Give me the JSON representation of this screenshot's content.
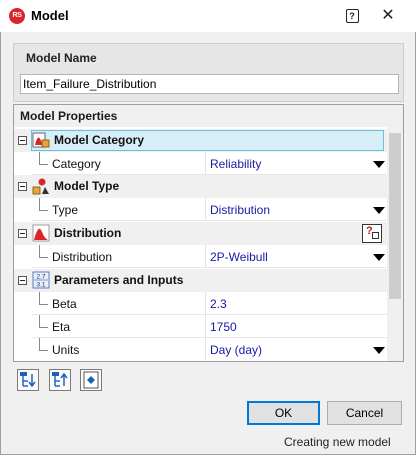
{
  "window": {
    "app_icon_text": "RS",
    "title": "Model",
    "help_glyph": "?",
    "close_glyph": "✕"
  },
  "model_name": {
    "label": "Model Name",
    "value": "Item_Failure_Distribution"
  },
  "properties": {
    "header": "Model Properties",
    "categories": [
      {
        "label": "Model Category",
        "icon": "model-category-icon",
        "selected": true,
        "props": [
          {
            "name": "Category",
            "value": "Reliability",
            "has_dropdown": true
          }
        ]
      },
      {
        "label": "Model Type",
        "icon": "model-type-icon",
        "props": [
          {
            "name": "Type",
            "value": "Distribution",
            "has_dropdown": true
          }
        ]
      },
      {
        "label": "Distribution",
        "icon": "distribution-icon",
        "has_info_button": true,
        "props": [
          {
            "name": "Distribution",
            "value": "2P-Weibull",
            "has_dropdown": true
          }
        ]
      },
      {
        "label": "Parameters and Inputs",
        "icon": "parameters-icon",
        "icon_text_top": "2.7",
        "icon_text_bottom": "3.1",
        "props": [
          {
            "name": "Beta",
            "value": "2.3"
          },
          {
            "name": "Eta",
            "value": "1750"
          },
          {
            "name": "Units",
            "value": "Day (day)",
            "has_dropdown": true
          }
        ]
      }
    ]
  },
  "buttons": {
    "ok": "OK",
    "cancel": "Cancel"
  },
  "status": "Creating new model",
  "colors": {
    "accent": "#0078d7",
    "value_text": "#1a1aa6",
    "selection_bg": "#d7eef8",
    "selection_border": "#69c0df",
    "logo_red": "#d9262c"
  }
}
